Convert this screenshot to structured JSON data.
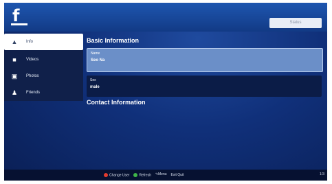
{
  "header": {
    "logo_text": "f",
    "status_label": "Status"
  },
  "sidebar": {
    "items": [
      {
        "label": "Info",
        "icon": "info-icon",
        "active": true
      },
      {
        "label": "Videos",
        "icon": "video-icon",
        "active": false
      },
      {
        "label": "Photos",
        "icon": "photos-icon",
        "active": false
      },
      {
        "label": "Friends",
        "icon": "friends-icon",
        "active": false
      }
    ]
  },
  "main": {
    "basic_title": "Basic Information",
    "fields": [
      {
        "key": "Name",
        "value": "Seo Na",
        "selected": true
      },
      {
        "key": "Sex",
        "value": "male",
        "selected": false
      }
    ],
    "contact_title": "Contact Information"
  },
  "footer": {
    "change_user": "Change User",
    "refresh": "Refresh",
    "menu": "Menu",
    "quit": "Quit",
    "menu_key": "⮌",
    "quit_key": "Exit",
    "page": "1/3"
  },
  "colors": {
    "accent": "#1e56b0",
    "red_button": "#e23b2e",
    "green_button": "#3fb548",
    "bg": "#10307a"
  }
}
